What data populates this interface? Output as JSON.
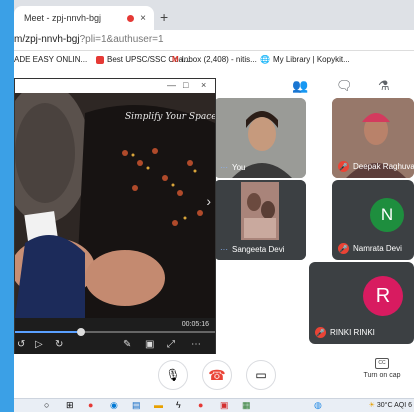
{
  "browser": {
    "tab_title": "Meet - zpj-nnvh-bgj",
    "tab_close": "×",
    "new_tab": "+",
    "url_main": "m/zpj-nnvh-bgj",
    "url_query": "?pli=1&authuser=1",
    "bookmarks": [
      {
        "label": "ADE EASY ONLIN...",
        "icon": "bookmark-icon"
      },
      {
        "label": "Best UPSC/SSC Coa...",
        "icon": "bookmark-icon"
      },
      {
        "label": "Inbox (2,408) - nitis...",
        "icon": "gmail-icon"
      },
      {
        "label": "My Library | Kopykit...",
        "icon": "globe-icon"
      }
    ]
  },
  "player": {
    "window_controls": [
      "—",
      "□",
      "×"
    ],
    "watermark": "Simplify Your Space",
    "time": "00:05:16",
    "progress": 0.33
  },
  "participants": [
    {
      "name": "You",
      "muted": false
    },
    {
      "name": "Deepak Raghuva...",
      "muted": true
    },
    {
      "name": "Sangeeta Devi",
      "muted": false
    },
    {
      "name": "Namrata Devi",
      "muted": true,
      "initial": "N",
      "color": "#1e8e3e"
    },
    {
      "name": "RINKI RINKI",
      "muted": true,
      "initial": "R",
      "color": "#d81b60"
    }
  ],
  "controls": {
    "caption_label": "Turn on cap"
  },
  "taskbar": {
    "weather": "30°C AQI 6"
  },
  "colors": {
    "desktop": "#3ba0e6",
    "end_call": "#ea4335",
    "meet_dark": "#3c4043"
  }
}
